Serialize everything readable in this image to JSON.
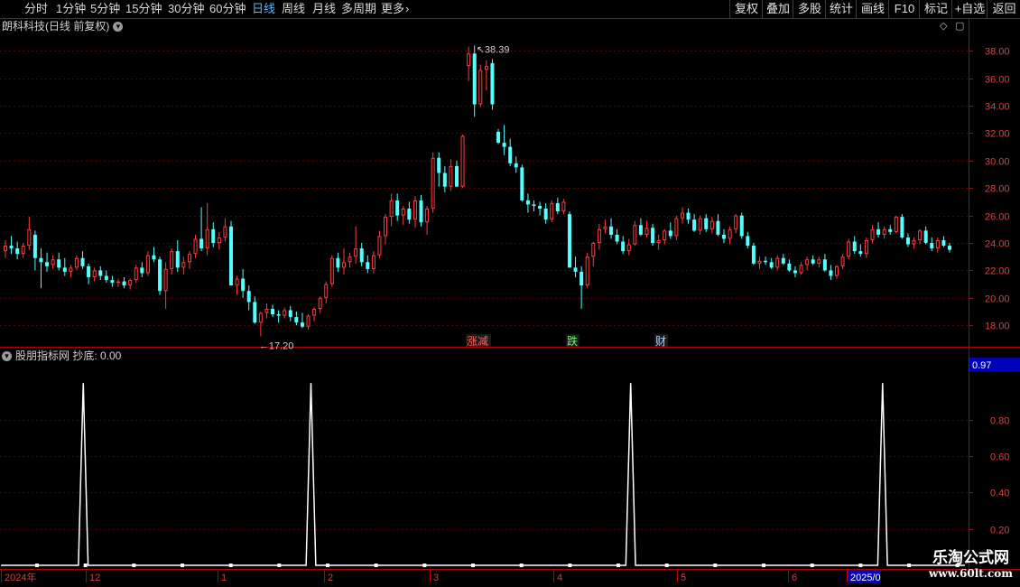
{
  "toolbar": {
    "tabs": [
      "分时",
      "1分钟",
      "5分钟",
      "15分钟",
      "30分钟",
      "60分钟",
      "日线",
      "周线",
      "月线",
      "多周期",
      "更多"
    ],
    "active_tab": "日线",
    "right_buttons": [
      "复权",
      "叠加",
      "多股",
      "统计",
      "画线",
      "F10",
      "标记",
      "+自选",
      "返回"
    ]
  },
  "main_chart": {
    "title": "朗科科技(日线 前复权)",
    "high_marker": "38.39",
    "low_marker": "17.20",
    "y_ticks": [
      "38.00",
      "36.00",
      "34.00",
      "32.00",
      "30.00",
      "28.00",
      "26.00",
      "24.00",
      "22.00",
      "20.00",
      "18.00"
    ],
    "events": [
      "涨减",
      "跌",
      "财"
    ],
    "colors": {
      "up": "#ff3c3c",
      "down": "#54ffff",
      "grid": "#5a0000",
      "axis": "#aa0000"
    }
  },
  "indicator": {
    "title": "股朋指标网 抄底: 0.00",
    "current_value": "0.97",
    "y_ticks": [
      "0.80",
      "0.60",
      "0.40",
      "0.20"
    ]
  },
  "date_axis": {
    "labels": [
      "2024年",
      "12",
      "1",
      "2",
      "3",
      "4",
      "5",
      "6",
      "2025/0"
    ]
  },
  "chart_data": [
    {
      "type": "candlestick",
      "title": "朗科科技(日线 前复权)",
      "ylim": [
        16.5,
        39.2
      ],
      "annotations": {
        "high": 38.39,
        "low": 17.2
      },
      "ohlc": [
        [
          23.4,
          24.2,
          22.9,
          23.8
        ],
        [
          23.8,
          24.5,
          23.2,
          23.6
        ],
        [
          23.6,
          24.1,
          22.8,
          23.2
        ],
        [
          23.2,
          24.0,
          22.9,
          23.8
        ],
        [
          23.8,
          25.9,
          23.5,
          25.0
        ],
        [
          24.6,
          24.9,
          22.0,
          22.9
        ],
        [
          22.9,
          23.6,
          20.7,
          22.6
        ],
        [
          22.6,
          23.3,
          21.9,
          22.3
        ],
        [
          22.4,
          23.1,
          22.1,
          22.8
        ],
        [
          22.8,
          23.3,
          22.0,
          22.2
        ],
        [
          22.2,
          22.9,
          21.6,
          21.9
        ],
        [
          21.9,
          22.4,
          21.5,
          22.2
        ],
        [
          22.2,
          23.1,
          22.0,
          22.9
        ],
        [
          22.9,
          23.4,
          22.1,
          22.3
        ],
        [
          22.3,
          22.5,
          21.0,
          21.5
        ],
        [
          21.5,
          22.2,
          21.2,
          22.0
        ],
        [
          22.0,
          22.3,
          21.3,
          21.6
        ],
        [
          21.6,
          22.0,
          21.1,
          21.3
        ],
        [
          21.3,
          21.6,
          20.8,
          21.1
        ],
        [
          21.1,
          21.4,
          20.8,
          21.2
        ],
        [
          21.2,
          21.5,
          20.7,
          20.9
        ],
        [
          20.9,
          21.4,
          20.6,
          21.3
        ],
        [
          21.3,
          22.4,
          21.1,
          22.2
        ],
        [
          22.2,
          22.6,
          21.5,
          21.8
        ],
        [
          21.8,
          23.4,
          21.6,
          23.1
        ],
        [
          23.1,
          23.7,
          22.6,
          22.8
        ],
        [
          22.8,
          23.0,
          20.2,
          20.5
        ],
        [
          20.5,
          22.6,
          19.2,
          22.1
        ],
        [
          22.1,
          23.6,
          21.7,
          23.4
        ],
        [
          23.4,
          24.2,
          21.9,
          22.2
        ],
        [
          22.2,
          23.0,
          21.7,
          22.6
        ],
        [
          22.6,
          23.4,
          22.1,
          23.2
        ],
        [
          23.2,
          24.6,
          22.9,
          24.3
        ],
        [
          24.3,
          26.6,
          23.4,
          23.6
        ],
        [
          23.6,
          26.9,
          23.1,
          25.0
        ],
        [
          25.0,
          25.5,
          23.7,
          24.0
        ],
        [
          24.0,
          24.8,
          23.5,
          24.4
        ],
        [
          24.4,
          25.8,
          24.1,
          25.2
        ],
        [
          25.2,
          25.6,
          23.6,
          20.9
        ],
        [
          20.9,
          21.6,
          20.2,
          21.4
        ],
        [
          21.4,
          22.1,
          20.0,
          20.5
        ],
        [
          20.5,
          20.9,
          19.1,
          19.7
        ],
        [
          19.7,
          20.1,
          18.1,
          18.2
        ],
        [
          18.2,
          19.0,
          17.2,
          18.9
        ],
        [
          18.9,
          19.6,
          18.5,
          19.2
        ],
        [
          19.2,
          19.5,
          18.6,
          18.8
        ],
        [
          18.8,
          19.1,
          18.2,
          18.7
        ],
        [
          18.7,
          19.3,
          18.5,
          19.1
        ],
        [
          19.1,
          19.4,
          18.3,
          18.6
        ],
        [
          18.6,
          19.0,
          18.0,
          18.2
        ],
        [
          18.2,
          18.9,
          17.8,
          17.9
        ],
        [
          17.9,
          18.8,
          17.7,
          18.7
        ],
        [
          18.7,
          19.3,
          18.3,
          19.2
        ],
        [
          19.2,
          20.1,
          18.9,
          20.0
        ],
        [
          20.0,
          21.2,
          19.6,
          21.0
        ],
        [
          21.0,
          23.1,
          20.8,
          22.9
        ],
        [
          22.9,
          23.3,
          21.9,
          22.2
        ],
        [
          22.2,
          23.6,
          21.7,
          22.6
        ],
        [
          22.6,
          23.3,
          22.2,
          23.0
        ],
        [
          23.0,
          25.2,
          22.5,
          23.6
        ],
        [
          23.6,
          24.0,
          22.3,
          22.6
        ],
        [
          22.6,
          23.1,
          21.8,
          22.1
        ],
        [
          22.1,
          23.4,
          21.8,
          23.1
        ],
        [
          23.1,
          24.9,
          22.9,
          24.5
        ],
        [
          24.5,
          26.1,
          23.9,
          25.9
        ],
        [
          25.9,
          27.6,
          25.2,
          27.1
        ],
        [
          27.1,
          27.6,
          25.6,
          26.0
        ],
        [
          26.0,
          26.7,
          25.3,
          26.5
        ],
        [
          26.5,
          27.0,
          25.4,
          25.7
        ],
        [
          25.7,
          27.4,
          25.1,
          27.1
        ],
        [
          27.1,
          27.5,
          25.2,
          25.5
        ],
        [
          25.5,
          26.7,
          24.6,
          26.5
        ],
        [
          26.5,
          30.6,
          26.2,
          30.2
        ],
        [
          30.2,
          30.6,
          28.1,
          29.1
        ],
        [
          29.1,
          29.6,
          27.7,
          28.1
        ],
        [
          28.1,
          30.1,
          27.8,
          29.6
        ],
        [
          29.6,
          30.0,
          28.2,
          28.1
        ],
        [
          28.1,
          31.9,
          28.0,
          31.8
        ],
        [
          36.9,
          38.3,
          35.8,
          37.8
        ],
        [
          37.8,
          38.39,
          33.2,
          34.1
        ],
        [
          34.1,
          37.0,
          33.9,
          36.6
        ],
        [
          36.6,
          37.3,
          35.1,
          36.9
        ],
        [
          37.1,
          37.4,
          33.7,
          34.1
        ],
        [
          32.1,
          32.3,
          31.2,
          31.3
        ],
        [
          31.3,
          32.6,
          30.4,
          31.0
        ],
        [
          31.0,
          31.6,
          29.6,
          29.8
        ],
        [
          29.8,
          30.3,
          29.1,
          29.5
        ],
        [
          29.5,
          29.7,
          27.0,
          27.1
        ],
        [
          27.1,
          27.6,
          26.2,
          26.8
        ],
        [
          26.8,
          27.1,
          26.3,
          26.7
        ],
        [
          26.7,
          27.0,
          26.0,
          26.5
        ],
        [
          26.5,
          26.9,
          25.4,
          25.7
        ],
        [
          25.7,
          27.1,
          25.5,
          26.9
        ],
        [
          26.9,
          27.3,
          26.1,
          26.3
        ],
        [
          26.3,
          27.2,
          26.1,
          27.0
        ],
        [
          26.1,
          26.3,
          22.6,
          22.2
        ],
        [
          22.2,
          23.0,
          21.5,
          21.9
        ],
        [
          21.9,
          22.3,
          19.2,
          20.9
        ],
        [
          20.9,
          23.3,
          20.7,
          23.0
        ],
        [
          23.0,
          24.1,
          22.3,
          24.0
        ],
        [
          24.0,
          25.4,
          23.5,
          25.0
        ],
        [
          25.0,
          25.7,
          24.7,
          25.2
        ],
        [
          25.2,
          25.8,
          24.3,
          24.6
        ],
        [
          24.6,
          25.0,
          23.9,
          24.1
        ],
        [
          24.1,
          24.5,
          23.2,
          23.4
        ],
        [
          23.4,
          24.3,
          23.1,
          23.9
        ],
        [
          23.9,
          25.6,
          23.8,
          25.3
        ],
        [
          25.3,
          25.8,
          24.5,
          24.6
        ],
        [
          24.6,
          25.6,
          24.4,
          25.1
        ],
        [
          25.1,
          25.4,
          23.8,
          24.0
        ],
        [
          24.0,
          24.6,
          23.5,
          24.2
        ],
        [
          24.2,
          25.0,
          23.9,
          24.9
        ],
        [
          24.9,
          25.5,
          24.3,
          24.5
        ],
        [
          24.5,
          26.0,
          24.2,
          25.8
        ],
        [
          25.8,
          26.6,
          25.4,
          26.2
        ],
        [
          26.2,
          26.5,
          25.4,
          25.7
        ],
        [
          25.7,
          26.1,
          24.8,
          24.9
        ],
        [
          24.9,
          26.0,
          24.6,
          25.8
        ],
        [
          25.8,
          26.1,
          24.8,
          25.0
        ],
        [
          25.0,
          25.9,
          24.7,
          25.6
        ],
        [
          25.6,
          26.1,
          24.5,
          24.6
        ],
        [
          24.6,
          25.0,
          24.0,
          24.3
        ],
        [
          24.3,
          25.2,
          23.9,
          25.0
        ],
        [
          25.0,
          26.1,
          24.7,
          26.0
        ],
        [
          26.0,
          26.2,
          24.3,
          24.5
        ],
        [
          24.5,
          24.8,
          23.6,
          23.8
        ],
        [
          23.8,
          24.0,
          22.4,
          22.5
        ],
        [
          22.5,
          23.0,
          22.1,
          22.7
        ],
        [
          22.7,
          23.0,
          22.4,
          22.6
        ],
        [
          22.6,
          22.9,
          22.1,
          22.2
        ],
        [
          22.2,
          23.1,
          22.0,
          22.9
        ],
        [
          22.9,
          23.2,
          22.4,
          22.5
        ],
        [
          22.5,
          22.8,
          21.9,
          22.0
        ],
        [
          22.0,
          22.3,
          21.5,
          21.8
        ],
        [
          21.8,
          22.6,
          21.7,
          22.4
        ],
        [
          22.4,
          23.0,
          22.0,
          22.8
        ],
        [
          22.8,
          23.1,
          22.4,
          22.5
        ],
        [
          22.5,
          23.0,
          22.2,
          22.8
        ],
        [
          22.8,
          23.2,
          21.9,
          22.0
        ],
        [
          22.0,
          22.4,
          21.3,
          21.6
        ],
        [
          21.6,
          22.4,
          21.4,
          22.3
        ],
        [
          22.3,
          23.2,
          22.1,
          23.0
        ],
        [
          23.0,
          24.3,
          22.8,
          24.1
        ],
        [
          24.1,
          24.5,
          23.2,
          23.4
        ],
        [
          23.4,
          23.9,
          23.0,
          23.2
        ],
        [
          23.2,
          24.4,
          22.9,
          24.2
        ],
        [
          24.2,
          25.3,
          24.0,
          25.0
        ],
        [
          25.0,
          25.5,
          24.4,
          24.6
        ],
        [
          24.6,
          25.2,
          24.3,
          25.0
        ],
        [
          25.0,
          25.3,
          24.6,
          24.8
        ],
        [
          24.8,
          26.0,
          24.7,
          25.9
        ],
        [
          25.9,
          26.1,
          24.3,
          24.4
        ],
        [
          24.4,
          24.7,
          23.7,
          23.9
        ],
        [
          23.9,
          24.4,
          23.6,
          24.2
        ],
        [
          24.2,
          25.0,
          23.9,
          24.9
        ],
        [
          24.9,
          25.2,
          23.9,
          24.0
        ],
        [
          24.0,
          24.4,
          23.4,
          23.6
        ],
        [
          23.6,
          24.4,
          23.3,
          24.2
        ],
        [
          24.2,
          24.5,
          23.7,
          23.8
        ],
        [
          23.8,
          24.0,
          23.3,
          23.5
        ]
      ]
    },
    {
      "type": "line",
      "title": "股朋指标网 抄底",
      "ylim": [
        0,
        1.1
      ],
      "baseline": 0.0,
      "spike_value": 1.0,
      "spike_indices": [
        17,
        64,
        130,
        182
      ],
      "marker_every": 10,
      "n_points": 200
    }
  ]
}
